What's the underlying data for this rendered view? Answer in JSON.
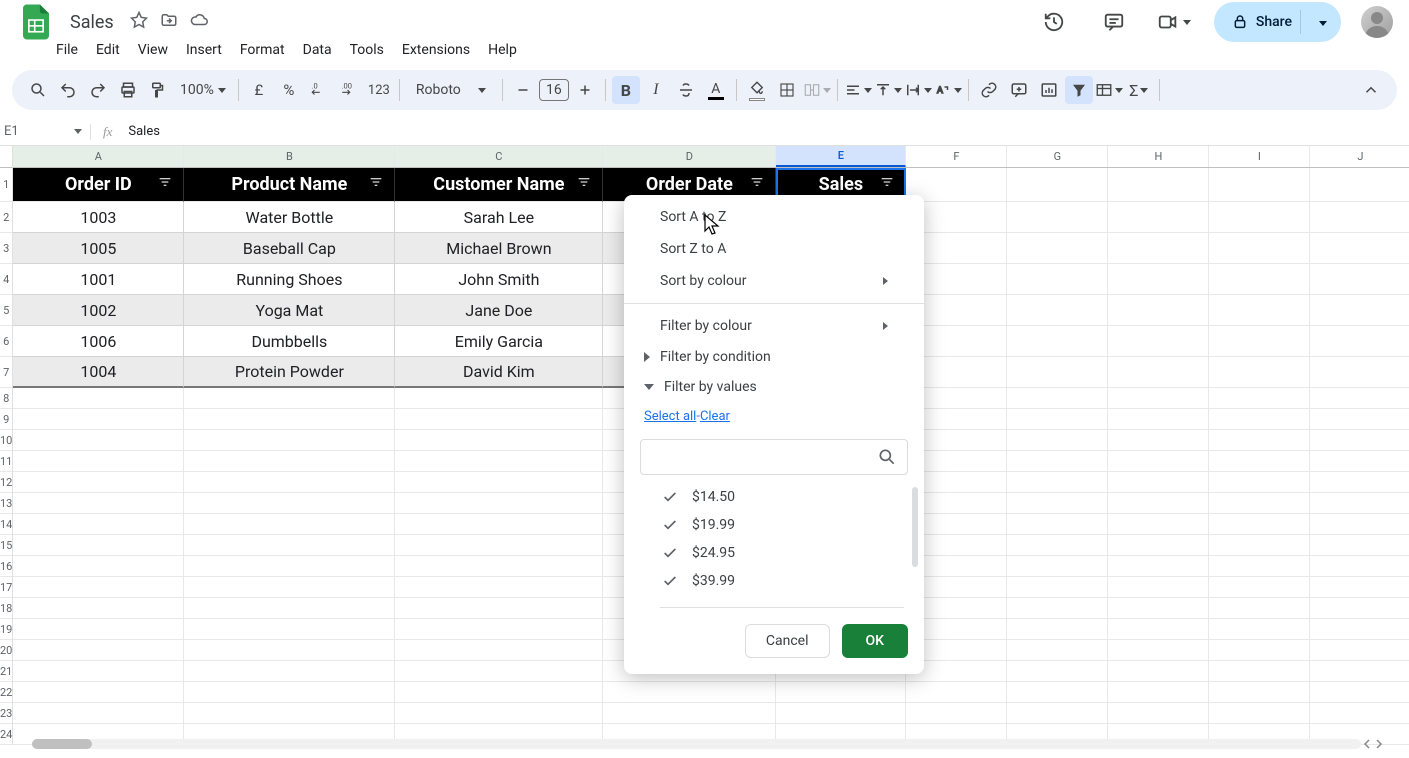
{
  "doc_title": "Sales",
  "menu": [
    "File",
    "Edit",
    "View",
    "Insert",
    "Format",
    "Data",
    "Tools",
    "Extensions",
    "Help"
  ],
  "share_label": "Share",
  "zoom": "100%",
  "font_name": "Roboto",
  "font_size": "16",
  "name_box": "E1",
  "fx_label": "fx",
  "formula_value": "Sales",
  "columns": [
    "A",
    "B",
    "C",
    "D",
    "E",
    "F",
    "G",
    "H",
    "I",
    "J"
  ],
  "table": {
    "headers": [
      "Order ID",
      "Product Name",
      "Customer Name",
      "Order Date",
      "Sales"
    ],
    "rows": [
      [
        "1003",
        "Water Bottle",
        "Sarah Lee"
      ],
      [
        "1005",
        "Baseball Cap",
        "Michael Brown"
      ],
      [
        "1001",
        "Running Shoes",
        "John Smith"
      ],
      [
        "1002",
        "Yoga Mat",
        "Jane Doe"
      ],
      [
        "1006",
        "Dumbbells",
        "Emily Garcia"
      ],
      [
        "1004",
        "Protein Powder",
        "David Kim"
      ]
    ]
  },
  "filter": {
    "sort_az": "Sort A to Z",
    "sort_za": "Sort Z to A",
    "sort_colour": "Sort by colour",
    "filter_colour": "Filter by colour",
    "filter_condition": "Filter by condition",
    "filter_values": "Filter by values",
    "select_all": "Select all",
    "clear": "Clear",
    "values": [
      "$14.50",
      "$19.99",
      "$24.95",
      "$39.99"
    ],
    "cancel": "Cancel",
    "ok": "OK"
  }
}
